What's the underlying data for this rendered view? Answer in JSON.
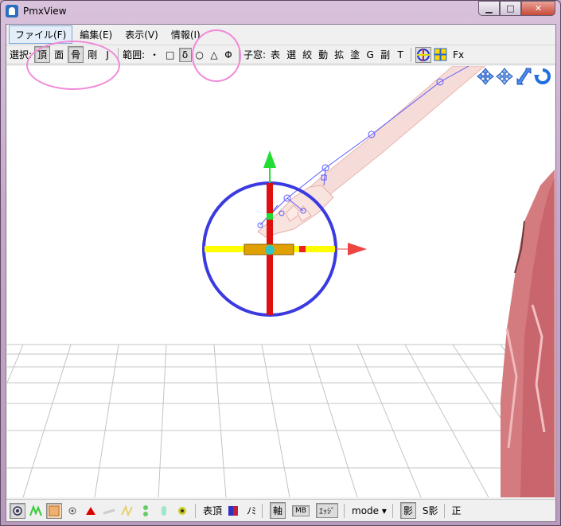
{
  "window": {
    "title": "PmxView",
    "minimize_label": "▁",
    "maximize_label": "□",
    "close_label": "✕"
  },
  "menu": [
    "ファイル(F)",
    "編集(E)",
    "表示(V)",
    "情報(I)"
  ],
  "toolbar": {
    "select_label": "選択:",
    "select_items": [
      {
        "label": "頂",
        "on": true
      },
      {
        "label": "面",
        "on": false
      },
      {
        "label": "骨",
        "on": true
      },
      {
        "label": "剛",
        "on": false
      },
      {
        "label": "J",
        "on": false
      }
    ],
    "range_label": "範囲:",
    "range_items": [
      {
        "label": "・",
        "on": false
      },
      {
        "label": "□",
        "on": false
      },
      {
        "label": "δ",
        "on": true
      },
      {
        "label": "○",
        "on": false
      },
      {
        "label": "△",
        "on": false
      },
      {
        "label": "Φ",
        "on": false
      }
    ],
    "child_label": "子窓:",
    "child_items": [
      "表",
      "選",
      "絞",
      "動",
      "拡",
      "塗",
      "G",
      "副",
      "T"
    ],
    "fx_label": "Fx"
  },
  "statusbar": {
    "vertex_label": "表頂",
    "nomi_label": "ﾉﾐ",
    "axis_label": "軸",
    "mb_label": "MB",
    "edge_label": "ｴｯｼﾞ",
    "mode_label": "mode ▾",
    "shadow_label": "影",
    "sshadow_label": "S影",
    "ortho_label": "正"
  },
  "colors": {
    "gizmo_ring": "#3a3ae0",
    "gizmo_x": "#ffff00",
    "gizmo_y": "#e01010",
    "arrow_up": "#22dd33",
    "arrow_right": "#ee4444",
    "bone": "#5a5aff",
    "annotation": "#f08ad8"
  }
}
